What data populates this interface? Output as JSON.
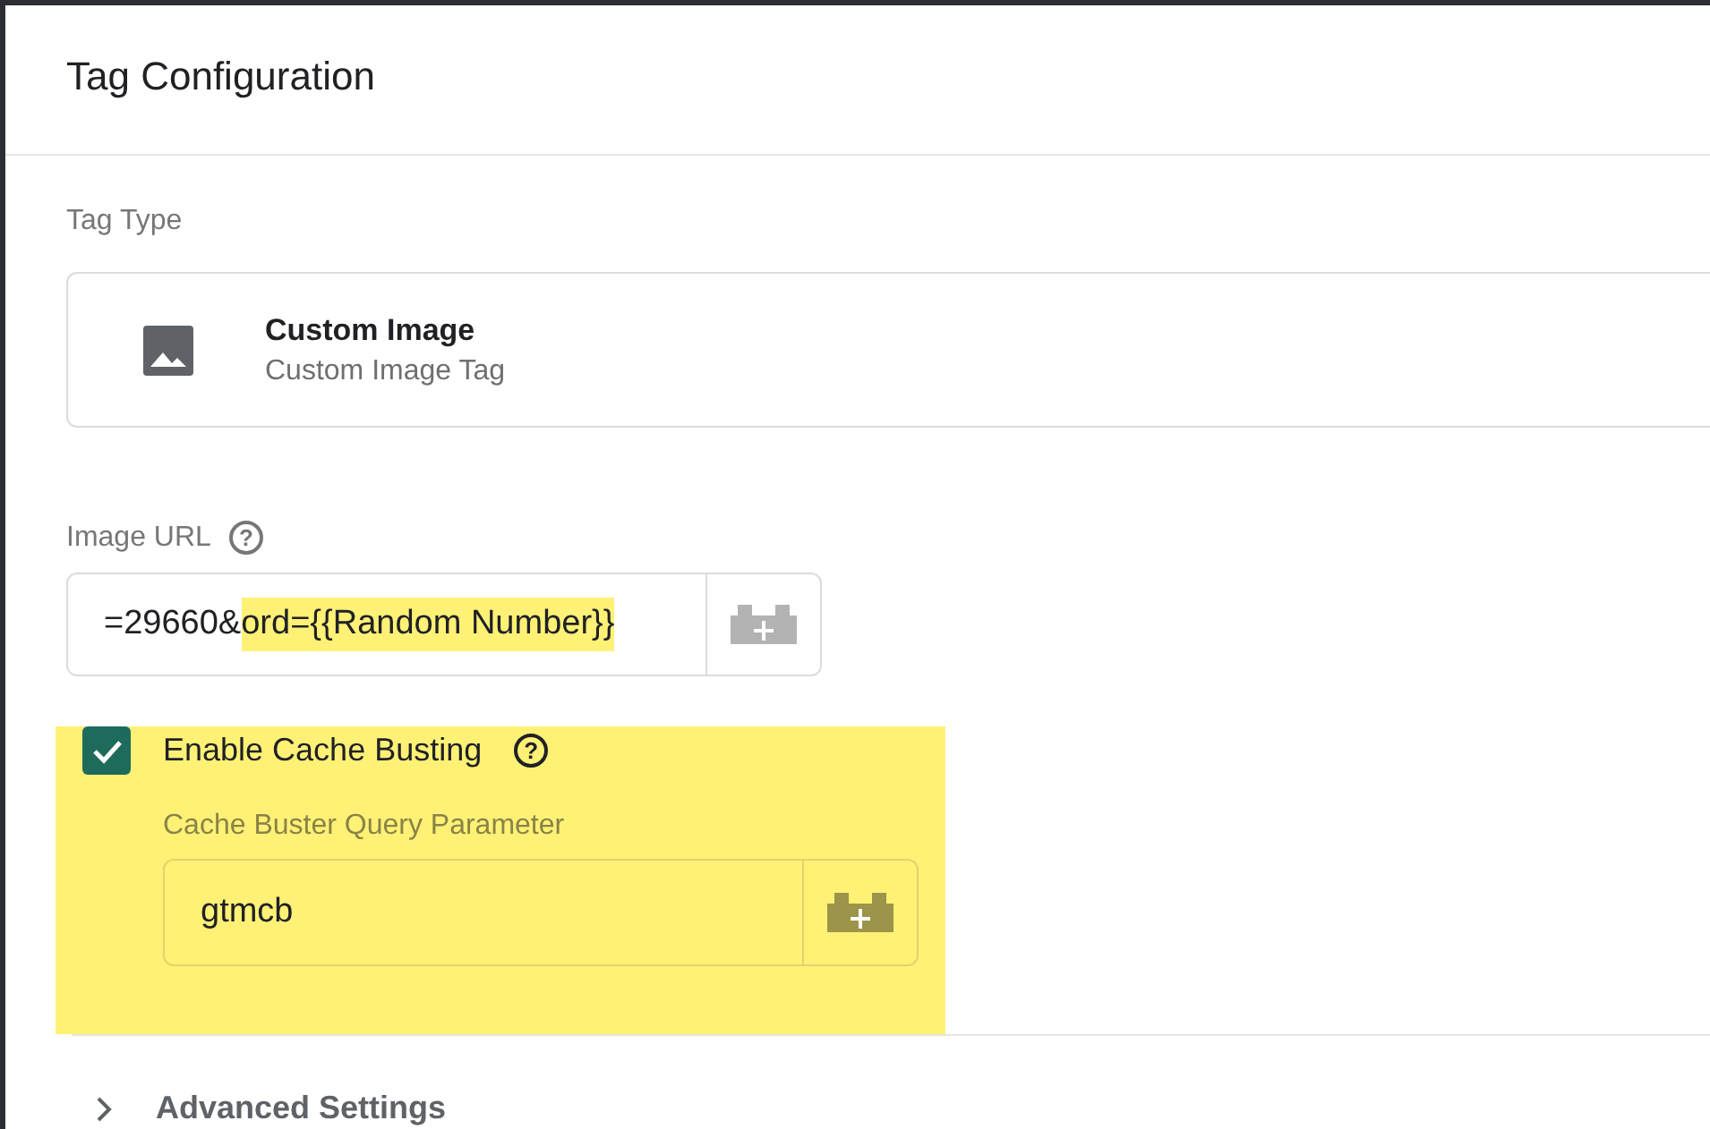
{
  "panel": {
    "title": "Tag Configuration"
  },
  "tag_type": {
    "label": "Tag Type",
    "name": "Custom Image",
    "description": "Custom Image Tag"
  },
  "image_url": {
    "label": "Image URL",
    "help": "?",
    "value_parts": [
      {
        "text": "=29660&",
        "highlighted": false
      },
      {
        "text": "ord={{Random Number}}",
        "highlighted": true
      }
    ]
  },
  "cache_busting": {
    "label": "Enable Cache Busting",
    "help": "?",
    "checked": true,
    "highlighted": true,
    "parameter_label": "Cache Buster Query Parameter",
    "parameter_value": "gtmcb"
  },
  "advanced": {
    "label": "Advanced Settings",
    "expanded": false
  }
}
